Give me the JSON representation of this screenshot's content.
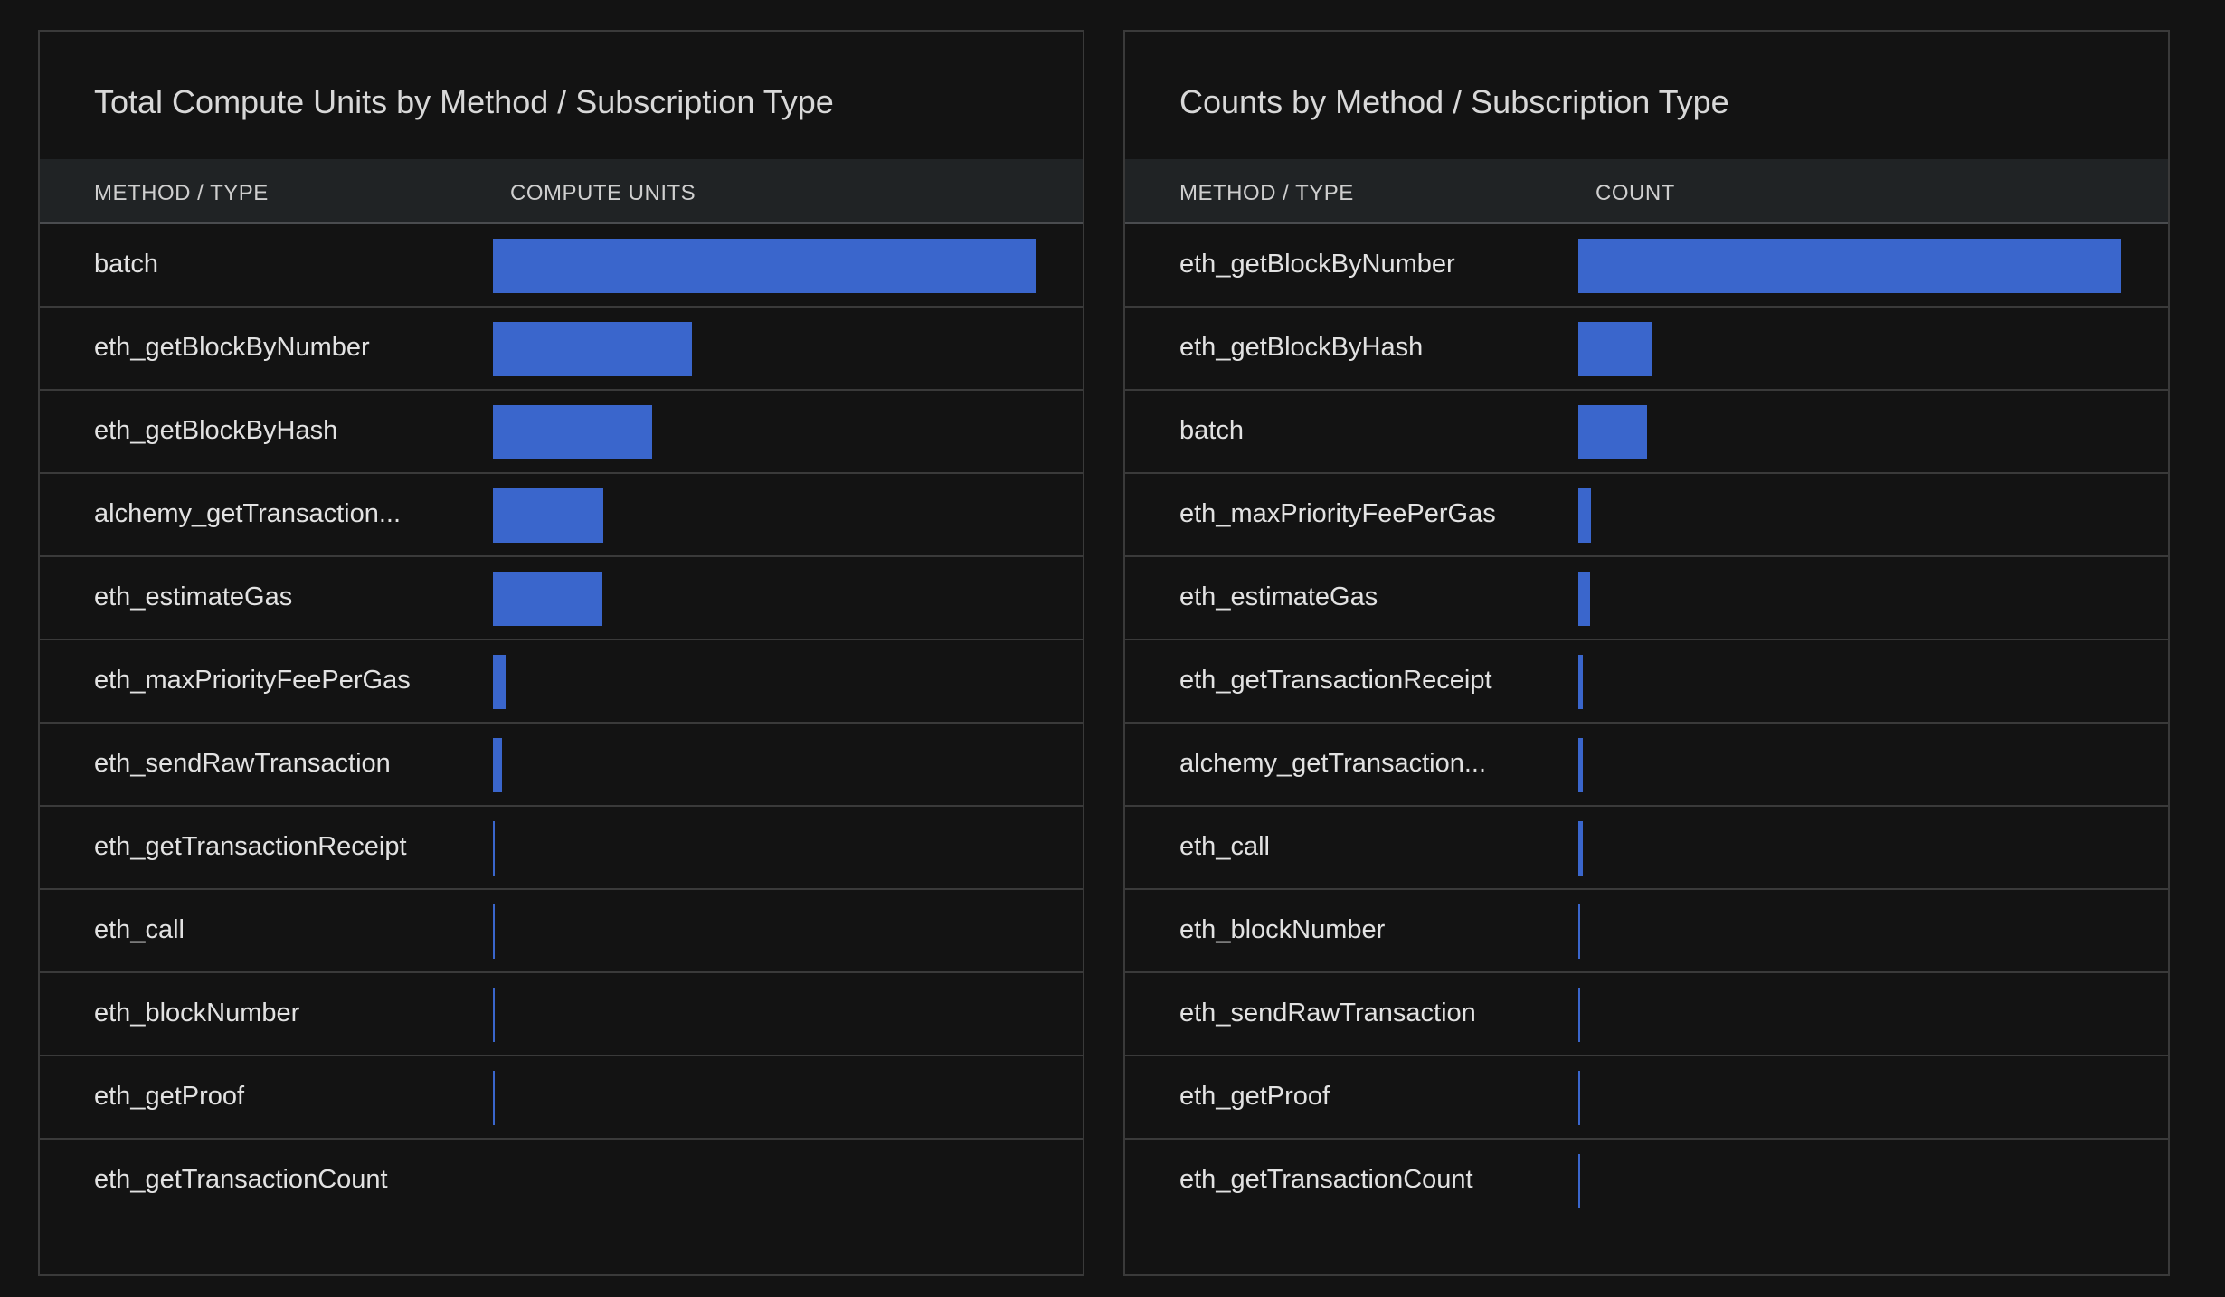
{
  "accent_color": "#3a66cc",
  "panels": [
    {
      "title": "Total Compute Units by Method / Subscription Type",
      "column_method": "METHOD / TYPE",
      "column_value": "COMPUTE UNITS",
      "rows": [
        {
          "label": "batch",
          "value": 1.0
        },
        {
          "label": "eth_getBlockByNumber",
          "value": 0.367
        },
        {
          "label": "eth_getBlockByHash",
          "value": 0.294
        },
        {
          "label": "alchemy_getTransaction...",
          "value": 0.203
        },
        {
          "label": "eth_estimateGas",
          "value": 0.201
        },
        {
          "label": "eth_maxPriorityFeePerGas",
          "value": 0.024
        },
        {
          "label": "eth_sendRawTransaction",
          "value": 0.016
        },
        {
          "label": "eth_getTransactionReceipt",
          "value": 0.004
        },
        {
          "label": "eth_call",
          "value": 0.003
        },
        {
          "label": "eth_blockNumber",
          "value": 0.003
        },
        {
          "label": "eth_getProof",
          "value": 0.003
        },
        {
          "label": "eth_getTransactionCount",
          "value": 0.0
        }
      ]
    },
    {
      "title": "Counts by Method / Subscription Type",
      "column_method": "METHOD / TYPE",
      "column_value": "COUNT",
      "rows": [
        {
          "label": "eth_getBlockByNumber",
          "value": 1.0
        },
        {
          "label": "eth_getBlockByHash",
          "value": 0.135
        },
        {
          "label": "batch",
          "value": 0.126
        },
        {
          "label": "eth_maxPriorityFeePerGas",
          "value": 0.024
        },
        {
          "label": "eth_estimateGas",
          "value": 0.022
        },
        {
          "label": "eth_getTransactionReceipt",
          "value": 0.008
        },
        {
          "label": "alchemy_getTransaction...",
          "value": 0.008
        },
        {
          "label": "eth_call",
          "value": 0.008
        },
        {
          "label": "eth_blockNumber",
          "value": 0.004
        },
        {
          "label": "eth_sendRawTransaction",
          "value": 0.004
        },
        {
          "label": "eth_getProof",
          "value": 0.004
        },
        {
          "label": "eth_getTransactionCount",
          "value": 0.004
        }
      ]
    }
  ]
}
